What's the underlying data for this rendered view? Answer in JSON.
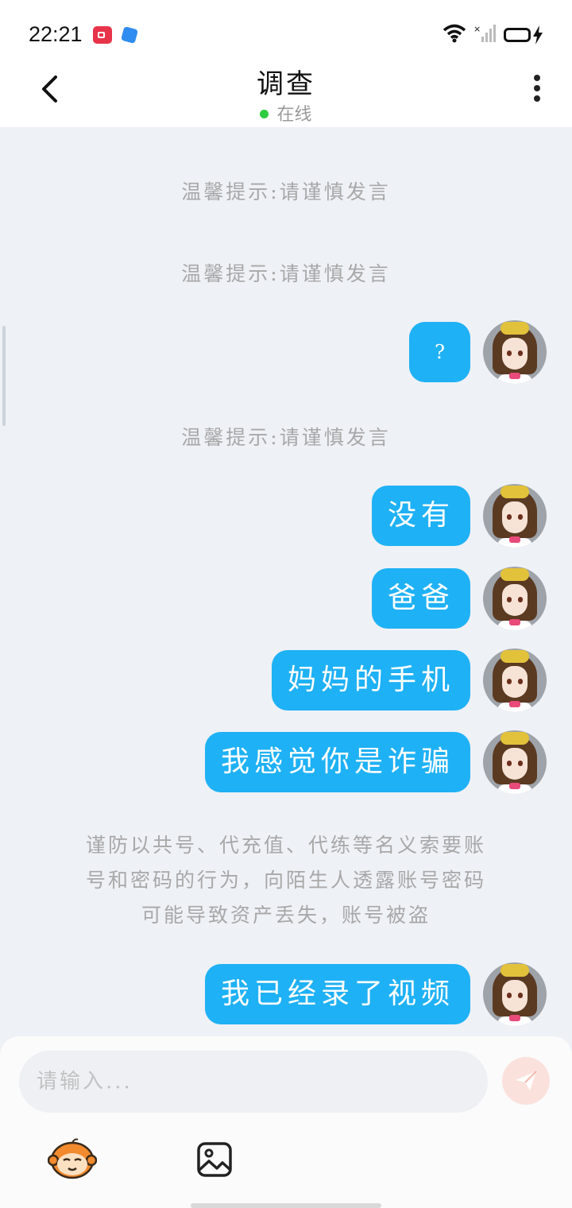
{
  "status_bar": {
    "time": "22:21"
  },
  "header": {
    "title": "调查",
    "status": "在线",
    "status_color": "#2ecc40"
  },
  "chat": {
    "system_tips": [
      "温馨提示:请谨慎发言",
      "温馨提示:请谨慎发言",
      "温馨提示:请谨慎发言"
    ],
    "messages": [
      "?",
      "没有",
      "爸爸",
      "妈妈的手机",
      "我感觉你是诈骗",
      "我已经录了视频"
    ],
    "warning_lines": [
      "谨防以共号、代充值、代练等名义索要账",
      "号和密码的行为，向陌生人透露账号密码",
      "可能导致资产丢失，账号被盗"
    ],
    "bubble_color": "#1fb1f5"
  },
  "composer": {
    "placeholder": "请输入...",
    "send_icon": "paper-plane-icon",
    "toolbar_icons": [
      "monkey-mascot-icon",
      "image-icon"
    ]
  }
}
